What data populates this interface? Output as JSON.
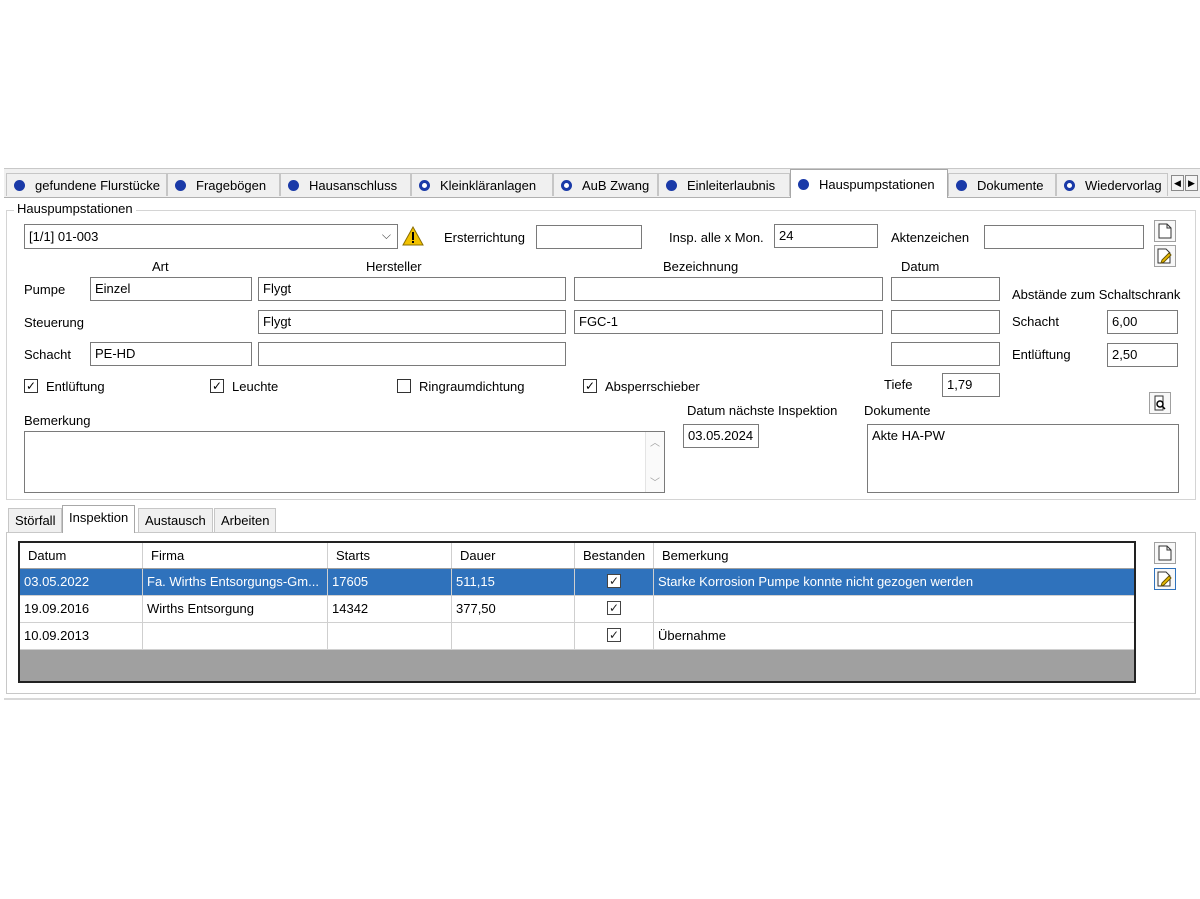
{
  "tabs": [
    {
      "label": "gefundene Flurstücke",
      "icon": "filled-dot-icon"
    },
    {
      "label": "Fragebögen",
      "icon": "filled-dot-icon"
    },
    {
      "label": "Hausanschluss",
      "icon": "filled-dot-icon"
    },
    {
      "label": "Kleinkläranlagen",
      "icon": "ring-dot-icon"
    },
    {
      "label": "AuB Zwang",
      "icon": "ring-dot-icon"
    },
    {
      "label": "Einleiterlaubnis",
      "icon": "filled-dot-icon"
    },
    {
      "label": "Hauspumpstationen",
      "icon": "filled-dot-icon",
      "active": true
    },
    {
      "label": "Dokumente",
      "icon": "filled-dot-icon"
    },
    {
      "label": "Wiedervorlag",
      "icon": "ring-dot-icon"
    }
  ],
  "group": {
    "title": "Hauspumpstationen",
    "record_select": "[1/1]  01-003",
    "ersterrichtung_label": "Ersterrichtung",
    "ersterrichtung_value": "",
    "insp_label": "Insp. alle x Mon.",
    "insp_value": "24",
    "aktenzeichen_label": "Aktenzeichen",
    "aktenzeichen_value": ""
  },
  "columns": {
    "art": "Art",
    "hersteller": "Hersteller",
    "bezeichnung": "Bezeichnung",
    "datum": "Datum"
  },
  "rows": {
    "pumpe": {
      "label": "Pumpe",
      "art": "Einzel",
      "hersteller": "Flygt",
      "bezeichnung": "",
      "datum": ""
    },
    "steuerung": {
      "label": "Steuerung",
      "hersteller": "Flygt",
      "bezeichnung": "FGC-1",
      "datum": ""
    },
    "schacht": {
      "label": "Schacht",
      "art": "PE-HD",
      "hersteller": "",
      "datum": ""
    }
  },
  "abstaende": {
    "title": "Abstände zum Schaltschrank",
    "schacht_label": "Schacht",
    "schacht_value": "6,00",
    "entlueftung_label": "Entlüftung",
    "entlueftung_value": "2,50"
  },
  "checks": {
    "entlueftung": {
      "label": "Entlüftung",
      "checked": true
    },
    "leuchte": {
      "label": "Leuchte",
      "checked": true
    },
    "ringraum": {
      "label": "Ringraumdichtung",
      "checked": false
    },
    "absperr": {
      "label": "Absperrschieber",
      "checked": true
    }
  },
  "tiefe": {
    "label": "Tiefe",
    "value": "1,79"
  },
  "bemerkung": {
    "label": "Bemerkung",
    "value": ""
  },
  "naechste": {
    "label": "Datum nächste Inspektion",
    "value": "03.05.2024"
  },
  "dokumente": {
    "label": "Dokumente",
    "items": [
      "Akte HA-PW"
    ]
  },
  "subtabs": [
    {
      "label": "Störfall"
    },
    {
      "label": "Inspektion",
      "active": true
    },
    {
      "label": "Austausch"
    },
    {
      "label": "Arbeiten"
    }
  ],
  "grid": {
    "headers": [
      "Datum",
      "Firma",
      "Starts",
      "Dauer",
      "Bestanden",
      "Bemerkung"
    ],
    "rows": [
      {
        "datum": "03.05.2022",
        "firma": "Fa. Wirths Entsorgungs-Gm...",
        "starts": "17605",
        "dauer": "511,15",
        "bestanden": true,
        "bemerkung": "Starke Korrosion Pumpe konnte nicht gezogen werden",
        "selected": true
      },
      {
        "datum": "19.09.2016",
        "firma": "Wirths Entsorgung",
        "starts": "14342",
        "dauer": "377,50",
        "bestanden": true,
        "bemerkung": ""
      },
      {
        "datum": "10.09.2013",
        "firma": "",
        "starts": "",
        "dauer": "",
        "bestanden": true,
        "bemerkung": "Übernahme"
      }
    ]
  },
  "colors": {
    "accent": "#1a3aa8",
    "selection": "#2f72bc",
    "warning": "#f2c200"
  }
}
